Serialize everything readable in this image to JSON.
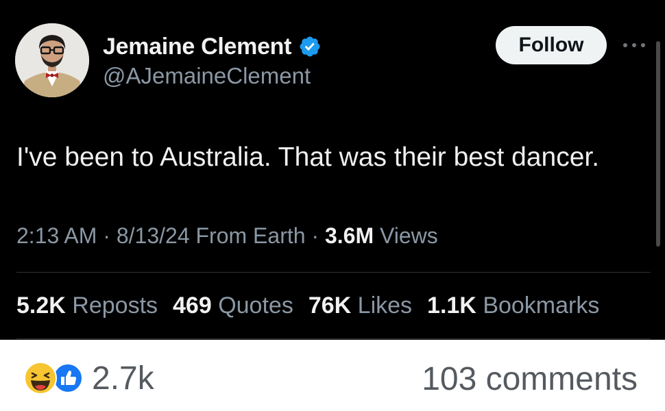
{
  "tweet": {
    "display_name": "Jemaine Clement",
    "handle": "@AJemaineClement",
    "follow_label": "Follow",
    "text": "I've been to Australia. That was their best dancer.",
    "time": "2:13 AM",
    "date": "8/13/24",
    "source": "From Earth",
    "views_count": "3.6M",
    "views_label": "Views",
    "separator": "·",
    "stats": [
      {
        "count": "5.2K",
        "label": "Reposts"
      },
      {
        "count": "469",
        "label": "Quotes"
      },
      {
        "count": "76K",
        "label": "Likes"
      },
      {
        "count": "1.1K",
        "label": "Bookmarks"
      }
    ],
    "icons": {
      "verified": "verified-badge-icon",
      "more": "more-horizontal-icon"
    },
    "colors": {
      "background": "#000000",
      "verified": "#1d9bf0",
      "muted": "#8b98a5",
      "follow_bg": "#eff3f4"
    }
  },
  "footer": {
    "reaction_count": "2.7k",
    "comments_label": "103 comments",
    "icons": [
      "haha-reaction-icon",
      "like-reaction-icon"
    ],
    "colors": {
      "like": "#1877f2",
      "haha": "#f7c531"
    }
  }
}
